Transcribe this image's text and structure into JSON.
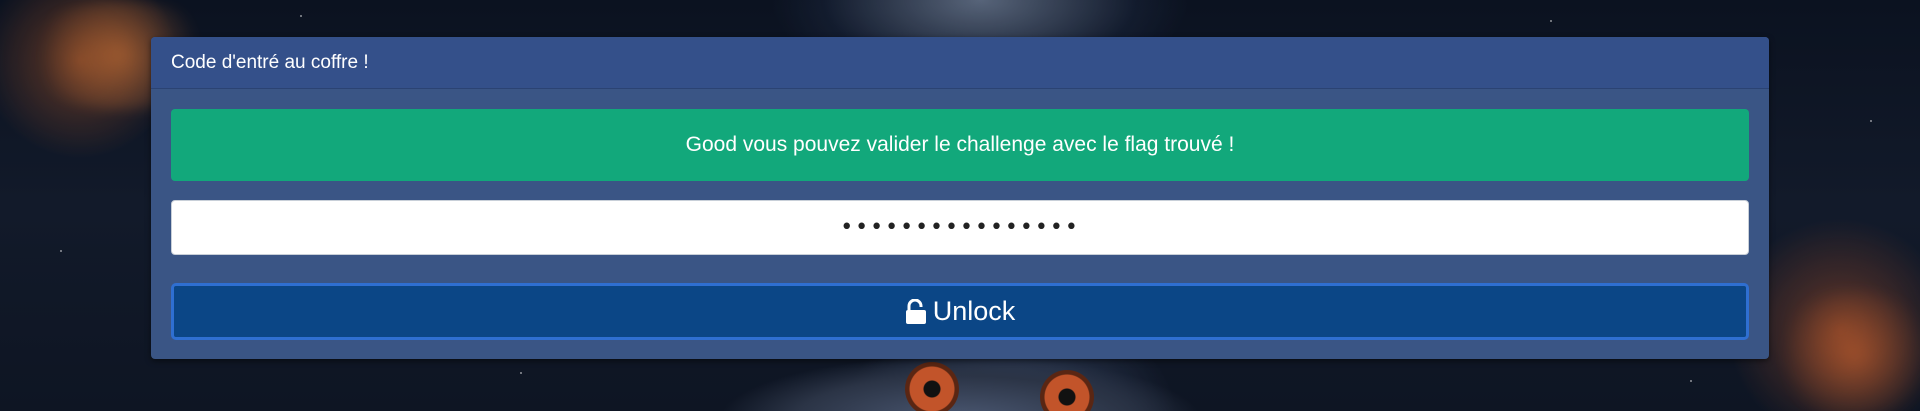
{
  "panel": {
    "title": "Code d'entré au coffre !"
  },
  "alert": {
    "message": "Good vous pouvez valider le challenge avec le flag trouvé !",
    "color": "#12a87b"
  },
  "code_input": {
    "value": "••••••••••••••••",
    "type": "password"
  },
  "unlock_button": {
    "label": "Unlock",
    "icon": "unlock-icon",
    "color": "#0b4686"
  }
}
